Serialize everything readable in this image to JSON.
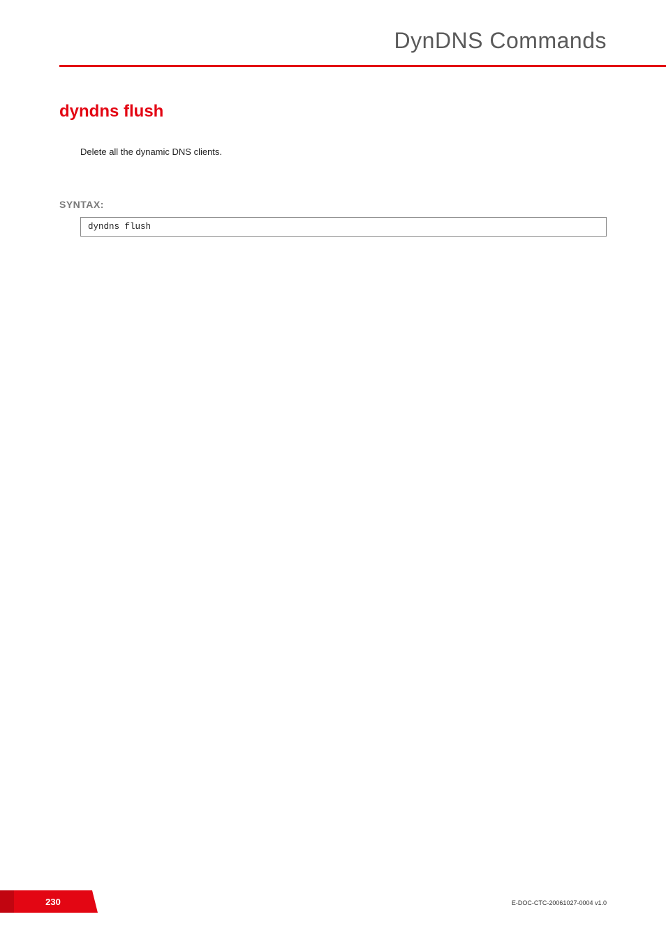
{
  "header": {
    "chapter_title": "DynDNS Commands"
  },
  "command": {
    "title": "dyndns flush",
    "description": "Delete all the dynamic DNS clients."
  },
  "syntax": {
    "label": "SYNTAX:",
    "code": "dyndns flush"
  },
  "footer": {
    "page_number": "230",
    "doc_id": "E-DOC-CTC-20061027-0004 v1.0"
  }
}
